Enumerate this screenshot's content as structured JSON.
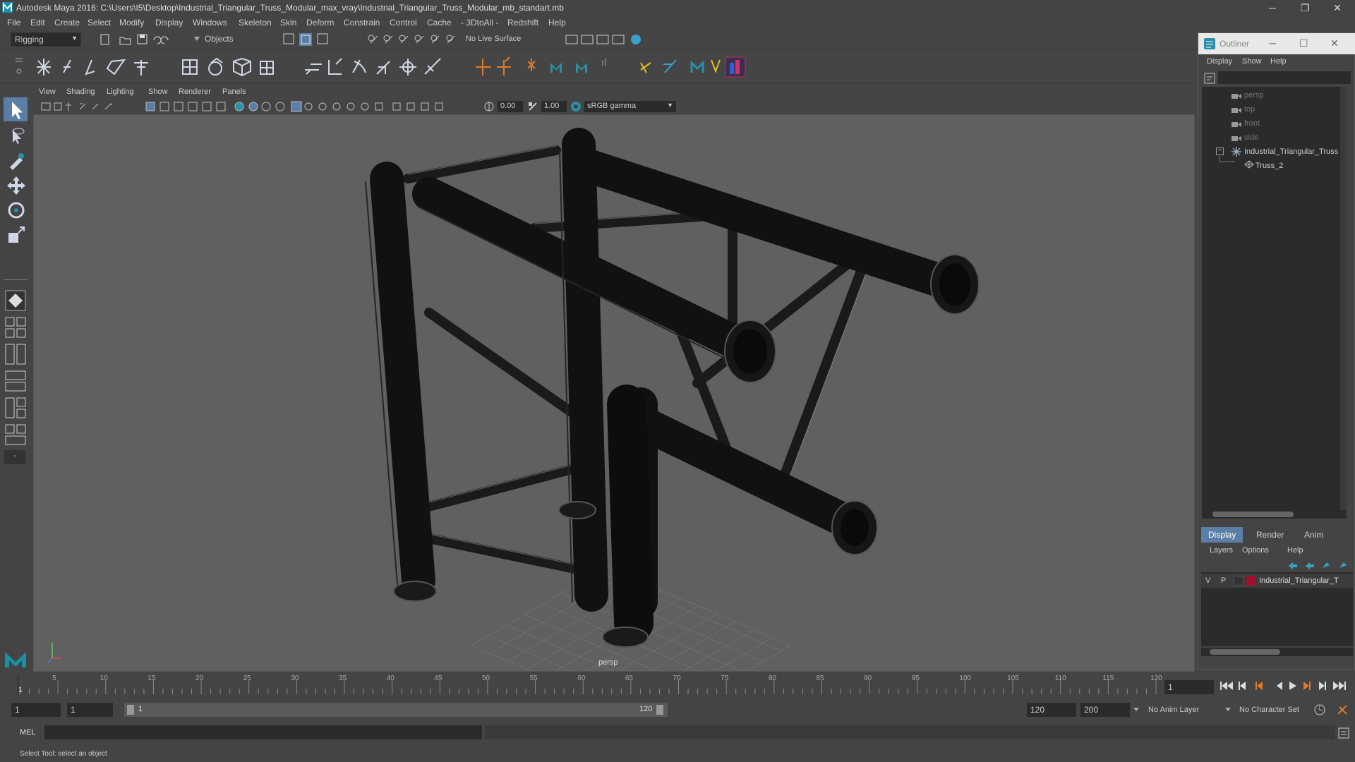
{
  "window": {
    "title": "Autodesk Maya 2016: C:\\Users\\I5\\Desktop\\Industrial_Triangular_Truss_Modular_max_vray\\Industrial_Triangular_Truss_Modular_mb_standart.mb",
    "minimize": "─",
    "restore": "❐",
    "close": "✕"
  },
  "menubar": [
    "File",
    "Edit",
    "Create",
    "Select",
    "Modify",
    "Display",
    "Windows",
    "Skeleton",
    "Skin",
    "Deform",
    "Constrain",
    "Control",
    "Cache",
    "- 3DtoAll -",
    "Redshift",
    "Help"
  ],
  "statusline": {
    "mode": "Rigging",
    "selection_mask": "Objects",
    "live_surface": "No Live Surface"
  },
  "viewport": {
    "menu": [
      "View",
      "Shading",
      "Lighting",
      "Show",
      "Renderer",
      "Panels"
    ],
    "exposure": "0.00",
    "gamma": "1.00",
    "color_space": "sRGB gamma",
    "camera_label": "persp"
  },
  "outliner": {
    "title": "Outliner",
    "menu": [
      "Display",
      "Show",
      "Help"
    ],
    "items": [
      {
        "label": "persp",
        "dim": true
      },
      {
        "label": "top",
        "dim": true
      },
      {
        "label": "front",
        "dim": true
      },
      {
        "label": "side",
        "dim": true
      },
      {
        "label": "Industrial_Triangular_Truss",
        "dim": false
      },
      {
        "label": "Truss_2",
        "dim": false
      }
    ]
  },
  "layers": {
    "tabs": [
      "Display",
      "Render",
      "Anim"
    ],
    "menu": [
      "Layers",
      "Options",
      "Help"
    ],
    "row": {
      "v": "V",
      "p": "P",
      "name": "Industrial_Triangular_T",
      "color": "#a0112e"
    }
  },
  "timeline": {
    "ticks": [
      5,
      10,
      15,
      20,
      25,
      30,
      35,
      40,
      45,
      50,
      55,
      60,
      65,
      70,
      75,
      80,
      85,
      90,
      95,
      100,
      105,
      110,
      115,
      120
    ],
    "start_marker": "1",
    "current_frame": "1"
  },
  "range": {
    "start": "1",
    "playback_start": "1",
    "slider_start": "1",
    "slider_end": "120",
    "playback_end": "120",
    "end": "200",
    "anim_layer": "No Anim Layer",
    "character_set": "No Character Set"
  },
  "cmdline": {
    "label": "MEL"
  },
  "helpline": {
    "text": "Select Tool: select an object"
  }
}
